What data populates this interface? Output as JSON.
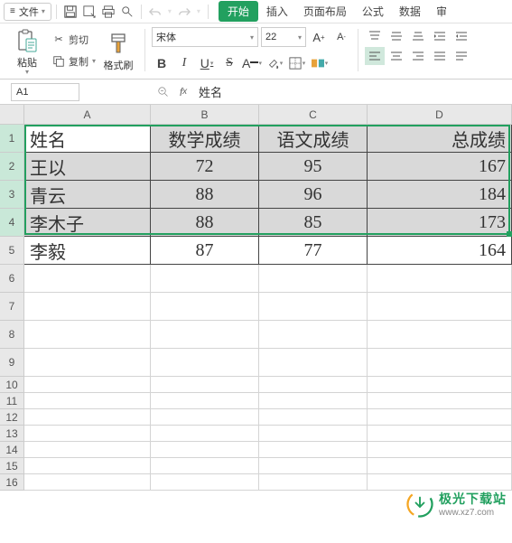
{
  "menu": {
    "file_label": "文件",
    "tabs": {
      "start": "开始",
      "insert": "插入",
      "layout": "页面布局",
      "formula": "公式",
      "data": "数据",
      "review": "审"
    }
  },
  "ribbon": {
    "paste_label": "粘贴",
    "cut_label": "剪切",
    "copy_label": "复制",
    "format_painter_label": "格式刷",
    "font_name": "宋体",
    "font_size": "22"
  },
  "formula_bar": {
    "cell_ref": "A1",
    "content": "姓名"
  },
  "columns": [
    {
      "label": "A",
      "width": 140
    },
    {
      "label": "B",
      "width": 120
    },
    {
      "label": "C",
      "width": 120
    },
    {
      "label": "D",
      "width": 160
    }
  ],
  "row_heights": {
    "data": 31,
    "empty": 22,
    "tight": 18
  },
  "sheet": {
    "header": {
      "name": "姓名",
      "math": "数学成绩",
      "chinese": "语文成绩",
      "total": "总成绩"
    },
    "rows": [
      {
        "name": "王以",
        "math": "72",
        "chinese": "95",
        "total": "167",
        "selected": true
      },
      {
        "name": "青云",
        "math": "88",
        "chinese": "96",
        "total": "184",
        "selected": true
      },
      {
        "name": "李木子",
        "math": "88",
        "chinese": "85",
        "total": "173",
        "selected": true
      },
      {
        "name": "李毅",
        "math": "87",
        "chinese": "77",
        "total": "164",
        "selected": false
      }
    ]
  },
  "chart_data": {
    "type": "table",
    "columns": [
      "姓名",
      "数学成绩",
      "语文成绩",
      "总成绩"
    ],
    "rows": [
      [
        "王以",
        72,
        95,
        167
      ],
      [
        "青云",
        88,
        96,
        184
      ],
      [
        "李木子",
        88,
        85,
        173
      ],
      [
        "李毅",
        87,
        77,
        164
      ]
    ]
  },
  "empty_row_labels": [
    "6",
    "7",
    "8",
    "9",
    "10",
    "11",
    "12",
    "13",
    "14",
    "15",
    "16"
  ],
  "watermark": {
    "title": "极光下载站",
    "url": "www.xz7.com"
  },
  "colors": {
    "accent": "#22a05f",
    "cell_border": "#d4d4d4",
    "data_bg": "#d9d9d9"
  }
}
